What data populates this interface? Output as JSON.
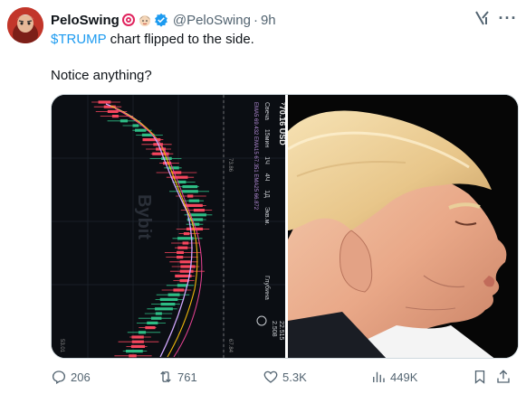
{
  "tweet": {
    "display_name": "PeloSwing",
    "name_emojis": [
      "target-emoji",
      "woman-emoji"
    ],
    "verified": true,
    "handle": "@PeloSwing",
    "separator": "·",
    "time": "9h",
    "cashtag": "$TRUMP",
    "text_line1_rest": " chart flipped to the side.",
    "text_line2": "Notice anything?"
  },
  "media": {
    "left_image": "trump-candlestick-chart-rotated",
    "right_image": "trump-profile-photo",
    "chart_labels": {
      "price": "⁷70.16 USD",
      "timeframes": [
        "Свеча",
        "15мин",
        "1Ч",
        "4Ч",
        "1Д",
        "Экв.м."
      ],
      "ema_line": "EMA5 69.432  EMA15 67.351  EMA25 66.872",
      "side_label": "Глубина",
      "right_numbers": [
        "22.515",
        "2.508"
      ],
      "axis_value_1": "73.86",
      "axis_value_2": "67.84",
      "axis_value_3": "53.01",
      "watermark": "Bybit"
    }
  },
  "actions": {
    "replies": "206",
    "retweets": "761",
    "likes": "5.3K",
    "views": "449K"
  },
  "colors": {
    "accent": "#1d9bf0",
    "muted": "#536471",
    "text": "#0f1419",
    "candle_up": "#2ebd85",
    "candle_down": "#f6465d"
  },
  "icons": [
    "reply-icon",
    "retweet-icon",
    "like-icon",
    "views-icon",
    "bookmark-icon",
    "share-icon",
    "grok-icon",
    "more-icon",
    "verified-icon"
  ]
}
